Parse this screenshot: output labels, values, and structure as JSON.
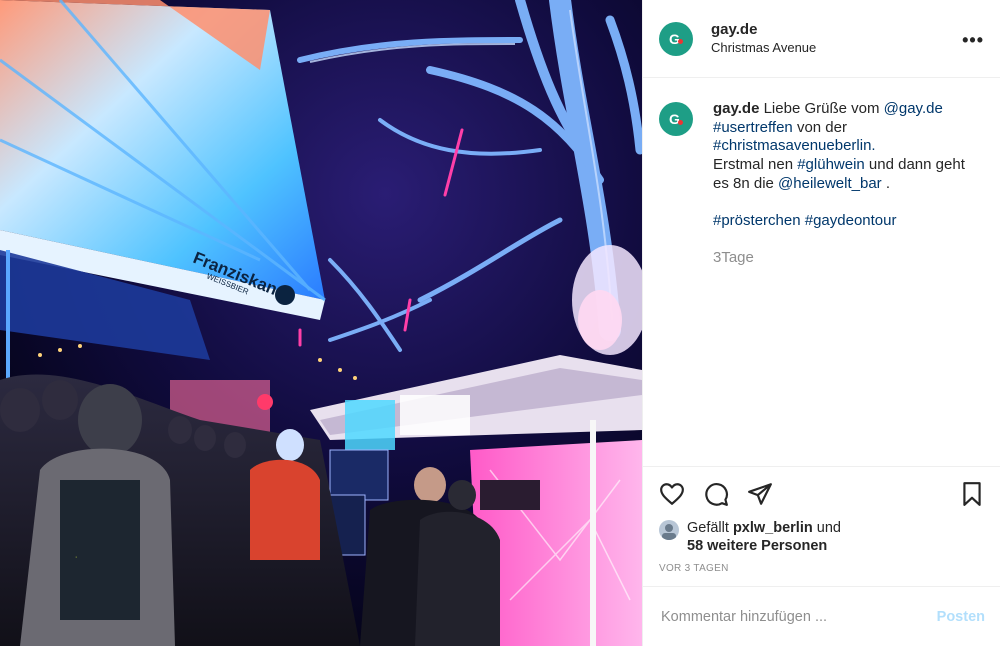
{
  "header": {
    "username": "gay.de",
    "location": "Christmas Avenue",
    "avatar_letter": "G",
    "more_label": "•••"
  },
  "caption": {
    "username": "gay.de",
    "segments": [
      {
        "text": "Liebe Grüße vom ",
        "type": "text"
      },
      {
        "text": "@gay.de",
        "type": "mention"
      },
      {
        "text": "#usertreffen",
        "type": "hashtag"
      },
      {
        "text": " von der ",
        "type": "text"
      },
      {
        "text": "#christmasavenueberlin.",
        "type": "hashtag"
      },
      {
        "text": "Erstmal nen ",
        "type": "text"
      },
      {
        "text": "#glühwein",
        "type": "hashtag"
      },
      {
        "text": " und dann geht es 8n die ",
        "type": "text"
      },
      {
        "text": "@heilewelt_bar",
        "type": "mention"
      },
      {
        "text": " .",
        "type": "text"
      },
      {
        "text": "#prösterchen",
        "type": "hashtag"
      },
      {
        "text": "#gaydeontour",
        "type": "hashtag"
      }
    ],
    "time": "3Tage"
  },
  "photo": {
    "umbrella_brand": "Franziskaner",
    "umbrella_sub": "WEISSBIER"
  },
  "actions": {
    "liked_by_prefix": "Gefällt",
    "liked_by_user": "pxlw_berlin",
    "liked_by_suffix": "und",
    "others": "58 weitere Personen",
    "posted_ago": "VOR 3 TAGEN"
  },
  "comment": {
    "placeholder": "Kommentar hinzufügen ...",
    "post_label": "Posten"
  },
  "colors": {
    "avatar": "#1e9e86",
    "link": "#00376b",
    "muted": "#8e8e8e",
    "post_button": "#b2dffc"
  }
}
